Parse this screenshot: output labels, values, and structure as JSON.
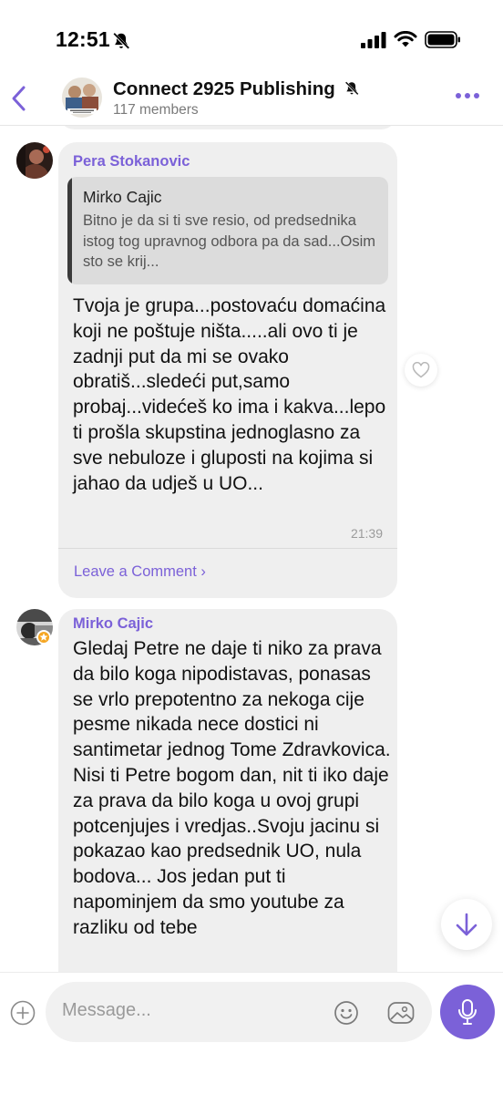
{
  "status_bar": {
    "time": "12:51"
  },
  "header": {
    "title": "Connect 2925 Publishing",
    "members": "117 members"
  },
  "messages": [
    {
      "sender": "Pera Stokanovic",
      "quote": {
        "author": "Mirko Cajic",
        "text": "Bitno je da si ti sve resio, od predsednika istog tog upravnog odbora pa da sad...Osim sto se krij..."
      },
      "text": "Tvoja je grupa...postovaću domaćina koji ne poštuje ništa.....ali ovo ti je zadnji put da mi se ovako obratiš...sledeći put,samo probaj...videćeš ko ima i kakva...lepo ti prošla skupstina jednoglasno za sve nebuloze i gluposti na kojima si jahao da udješ u UO...",
      "time": "21:39",
      "comment_link": "Leave a Comment ›"
    },
    {
      "sender": "Mirko Cajic",
      "text": "Gledaj Petre ne daje ti niko za prava da bilo koga nipodistavas, ponasas se vrlo prepotentno za nekoga cije pesme nikada nece dostici ni santimetar jednog Tome Zdravkovica. Nisi ti Petre bogom dan, nit ti iko daje za prava da bilo koga u ovoj grupi potcenjujes i vredjas..Svoju jacinu si pokazao kao predsednik UO, nula bodova... Jos jedan put ti napominjem da smo youtube za razliku od tebe"
    }
  ],
  "composer": {
    "placeholder": "Message..."
  },
  "colors": {
    "accent": "#7b61d8",
    "bubble": "#efefef",
    "quote_bg": "#dcdcdc",
    "badge": "#f5a623"
  },
  "icons": {
    "back": "chevron-left-icon",
    "more": "more-dots-icon",
    "mute": "bell-off-icon",
    "like": "heart-icon",
    "scroll": "arrow-down-icon",
    "attach": "plus-circle-icon",
    "emoji": "smiley-icon",
    "gallery": "image-icon",
    "mic": "microphone-icon"
  }
}
